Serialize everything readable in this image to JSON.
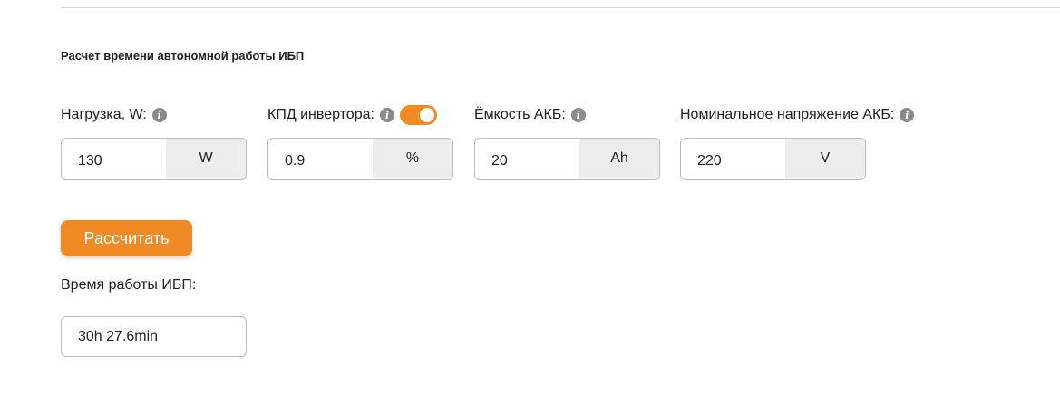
{
  "section_title": "Расчет времени автономной работы ИБП",
  "fields": [
    {
      "label": "Нагрузка, W:",
      "value": "130",
      "unit": "W"
    },
    {
      "label": "КПД инвертора:",
      "value": "0.9",
      "unit": "%",
      "toggle_on": true
    },
    {
      "label": "Ёмкость АКБ:",
      "value": "20",
      "unit": "Ah"
    },
    {
      "label": "Номинальное напряжение АКБ:",
      "value": "220",
      "unit": "V"
    }
  ],
  "info_icon_glyph": "i",
  "calculate_button": "Рассчитать",
  "result": {
    "label": "Время работы ИБП:",
    "value": "30h 27.6min"
  },
  "colors": {
    "accent": "#f08a24",
    "unit_bg": "#ededed",
    "border": "#bdbdbd",
    "info_icon": "#8a8a8a"
  }
}
